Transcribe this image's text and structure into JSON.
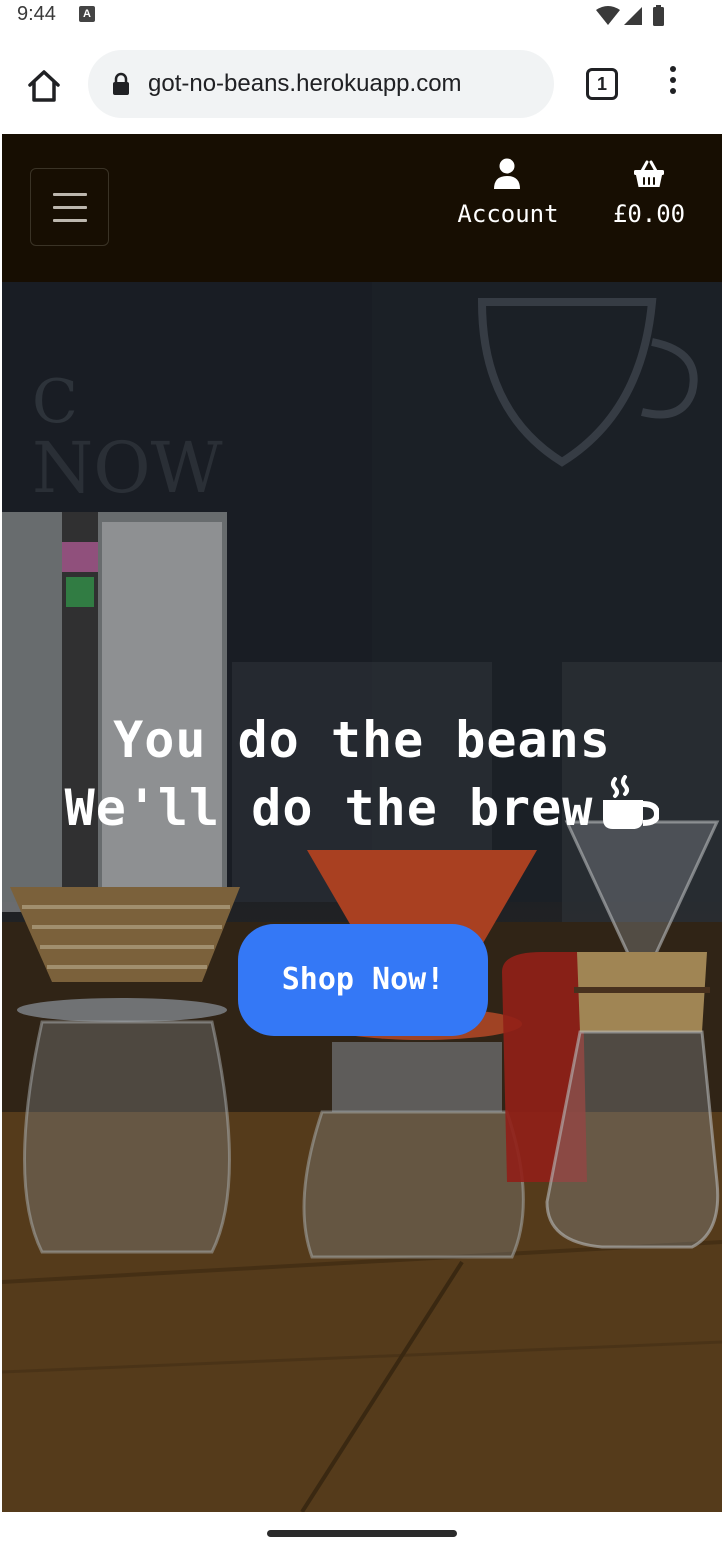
{
  "status_bar": {
    "time": "9:44",
    "notification_icon_letter": "A",
    "icons": [
      "notification-a-icon",
      "wifi-icon",
      "cell-signal-icon",
      "battery-icon"
    ]
  },
  "browser": {
    "url": "got-no-beans.herokuapp.com",
    "tab_count": "1",
    "icons": [
      "home-icon",
      "lock-icon",
      "tab-switcher-icon",
      "more-vert-icon"
    ]
  },
  "header": {
    "account_label": "Account",
    "basket_total": "£0.00",
    "icons": [
      "hamburger-menu-icon",
      "user-icon",
      "shopping-basket-icon"
    ],
    "colors": {
      "background": "#170e02",
      "text": "#ffffff"
    }
  },
  "hero": {
    "headline_line1": "You do the beans",
    "headline_line2": "We'll do the brew",
    "cta_label": "Shop Now!",
    "icons": [
      "coffee-cup-icon"
    ],
    "colors": {
      "cta_background": "#3478f6",
      "headline": "#ffffff"
    }
  }
}
